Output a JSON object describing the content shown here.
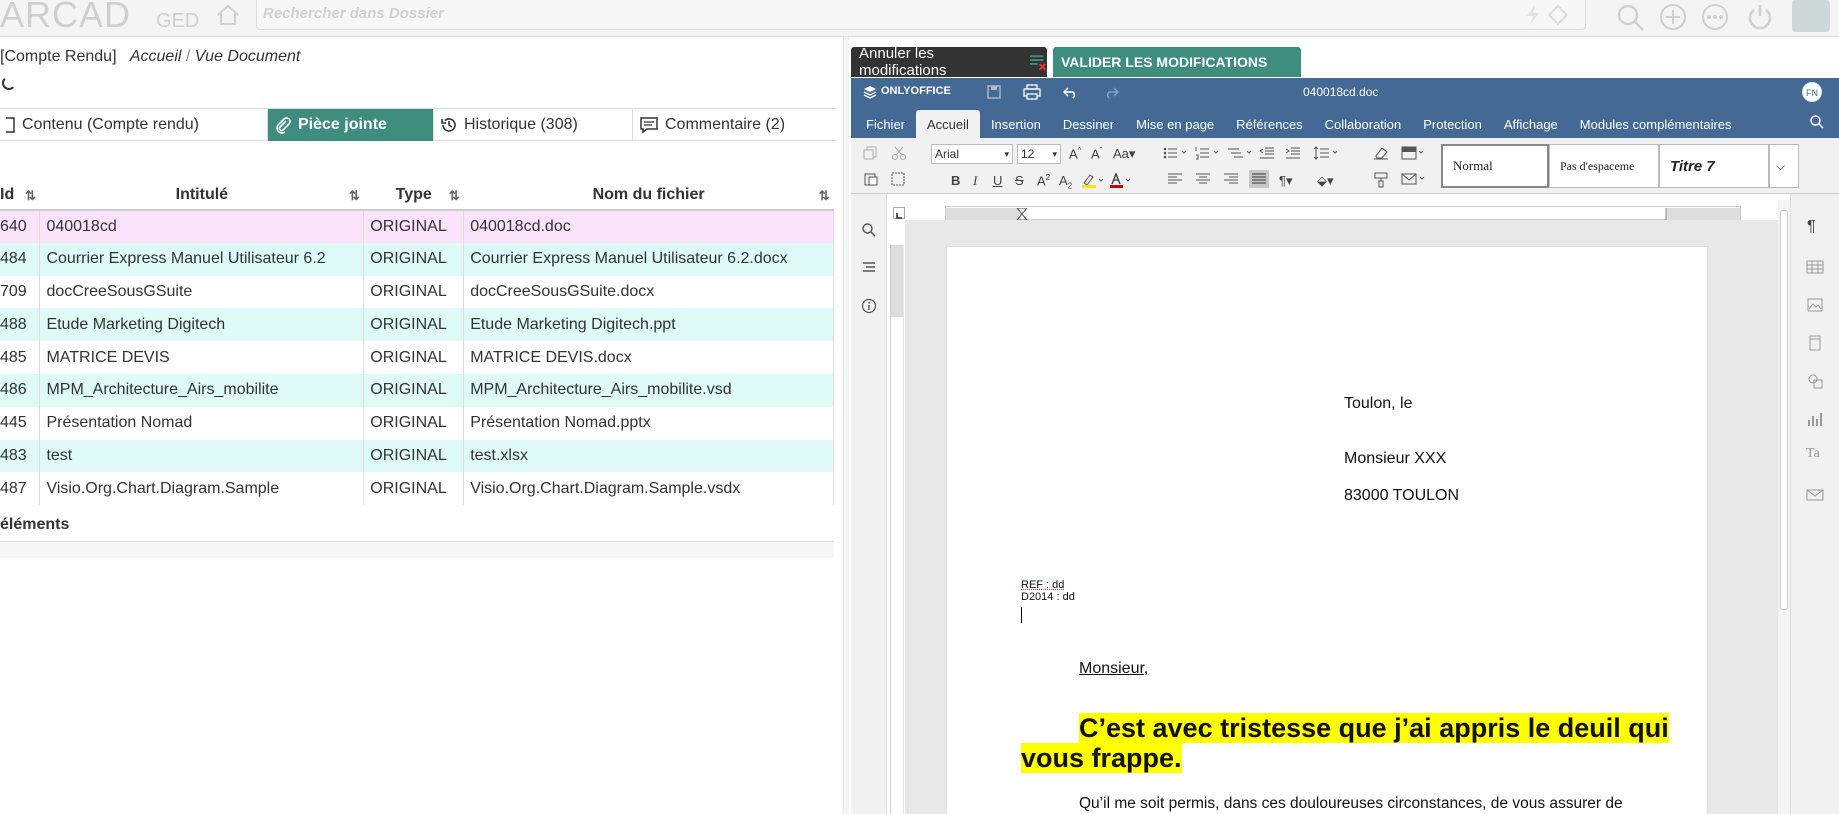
{
  "app": {
    "logo_text": "ARCAD",
    "logo_suffix": "GED",
    "search_placeholder": "Rechercher dans Dossier"
  },
  "breadcrumb": {
    "prefix": "[Compte Rendu]",
    "home": "Accueil",
    "separator": "/",
    "current": "Vue Document"
  },
  "tabs": [
    {
      "label": "Contenu (Compte rendu)",
      "icon": "document-icon",
      "active": false
    },
    {
      "label": "Pièce jointe",
      "icon": "paperclip-icon",
      "active": true
    },
    {
      "label": "Historique (308)",
      "icon": "history-icon",
      "active": false
    },
    {
      "label": "Commentaire (2)",
      "icon": "comment-icon",
      "active": false
    }
  ],
  "table": {
    "columns": [
      "Id",
      "Intitulé",
      "Type",
      "Nom du fichier"
    ],
    "rows": [
      {
        "id": "640",
        "title": "040018cd",
        "type": "ORIGINAL",
        "file": "040018cd.doc"
      },
      {
        "id": "484",
        "title": "Courrier Express Manuel Utilisateur 6.2",
        "type": "ORIGINAL",
        "file": "Courrier Express Manuel Utilisateur 6.2.docx"
      },
      {
        "id": "709",
        "title": "docCreeSousGSuite",
        "type": "ORIGINAL",
        "file": "docCreeSousGSuite.docx"
      },
      {
        "id": "488",
        "title": "Etude Marketing Digitech",
        "type": "ORIGINAL",
        "file": "Etude Marketing Digitech.ppt"
      },
      {
        "id": "485",
        "title": "MATRICE DEVIS",
        "type": "ORIGINAL",
        "file": "MATRICE DEVIS.docx"
      },
      {
        "id": "486",
        "title": "MPM_Architecture_Airs_mobilite",
        "type": "ORIGINAL",
        "file": "MPM_Architecture_Airs_mobilite.vsd"
      },
      {
        "id": "445",
        "title": "Présentation Nomad",
        "type": "ORIGINAL",
        "file": "Présentation Nomad.pptx"
      },
      {
        "id": "483",
        "title": "test",
        "type": "ORIGINAL",
        "file": "test.xlsx"
      },
      {
        "id": "487",
        "title": "Visio.Org.Chart.Diagram.Sample",
        "type": "ORIGINAL",
        "file": "Visio.Org.Chart.Diagram.Sample.vsdx"
      }
    ],
    "footer": "éléments"
  },
  "editor": {
    "cancel_label": "Annuler les modifications",
    "validate_label": "VALIDER LES MODIFICATIONS",
    "brand": "ONLYOFFICE",
    "filename": "040018cd.doc",
    "user_initials": "FN",
    "menu": [
      "Fichier",
      "Accueil",
      "Insertion",
      "Dessiner",
      "Mise en page",
      "Références",
      "Collaboration",
      "Protection",
      "Affichage",
      "Modules complémentaires"
    ],
    "active_menu": "Accueil",
    "font_name": "Arial",
    "font_size": "12",
    "styles": [
      "Normal",
      "Pas d'espaceme",
      "Titre 7"
    ]
  },
  "document": {
    "date_line": "Toulon, le",
    "recipient": "Monsieur XXX",
    "city": "83000 TOULON",
    "ref_line": "REF : dd",
    "d2014_line": "D2014 : dd",
    "salutation": "Monsieur,",
    "headline_1": "C’est avec tristesse que j’ai appris le deuil qui",
    "headline_2": "vous frappe.",
    "body_start": "Qu’il me soit permis, dans ces douloureuses circonstances, de vous assurer de"
  },
  "colors": {
    "accent": "#3f8d7d",
    "editor_header": "#446995",
    "row_alt": "#dffbf8",
    "row_selected": "#fbe3fb",
    "highlight": "#ffff00"
  }
}
